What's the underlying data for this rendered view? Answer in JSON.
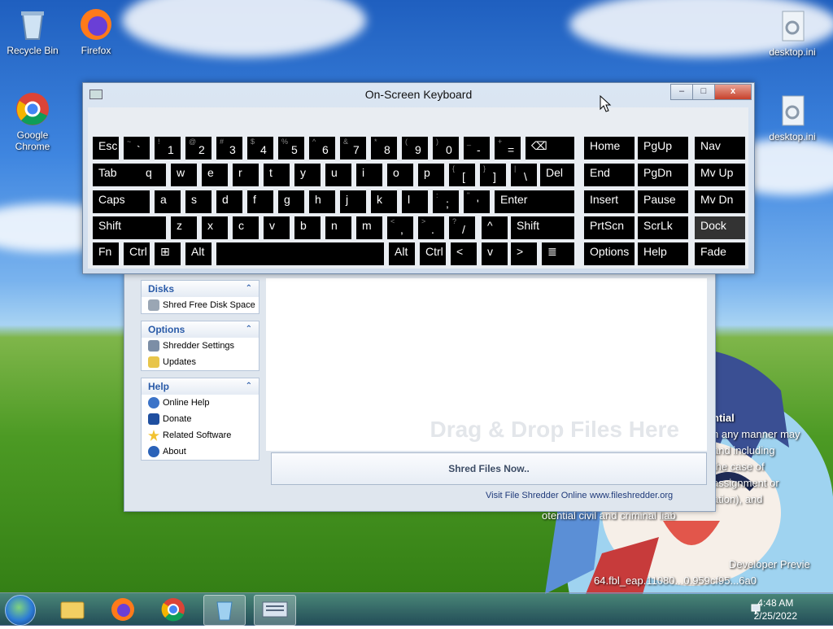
{
  "desktop": {
    "icons": [
      {
        "label": "Recycle Bin",
        "icon": "recycle-bin-icon"
      },
      {
        "label": "Firefox",
        "icon": "firefox-icon"
      },
      {
        "label": "Google Chrome",
        "icon": "chrome-icon"
      },
      {
        "label": "desktop.ini",
        "icon": "settings-file-icon"
      },
      {
        "label": "desktop.ini",
        "icon": "settings-file-icon"
      }
    ],
    "watermark_lines": [
      "ntial",
      "n any manner may",
      "and including",
      "the case of",
      "assignment or",
      "ation), and",
      "otential civil and criminal liab"
    ],
    "watermark_footer": [
      "Developer Previe",
      "64.fbl_eap.11080...0.959cf95...6a0"
    ]
  },
  "osk": {
    "title": "On-Screen Keyboard",
    "minimize": "–",
    "maximize": "□",
    "close": "x"
  },
  "keys": {
    "esc": "Esc",
    "tab": "Tab",
    "caps": "Caps",
    "shift": "Shift",
    "fn": "Fn",
    "ctrl": "Ctrl",
    "alt": "Alt",
    "backspace": "⌫",
    "del": "Del",
    "enter": "Enter",
    "home": "Home",
    "pgup": "PgUp",
    "nav": "Nav",
    "end": "End",
    "pgdn": "PgDn",
    "mvup": "Mv Up",
    "insert": "Insert",
    "pause": "Pause",
    "mvdn": "Mv Dn",
    "prtscn": "PrtScn",
    "scrlk": "ScrLk",
    "dock": "Dock",
    "options": "Options",
    "help": "Help",
    "fade": "Fade",
    "left": "<",
    "down": "v",
    "right": ">",
    "up": "^",
    "menu": "≣",
    "row1": [
      [
        "~",
        "`"
      ],
      [
        "!",
        "1"
      ],
      [
        "@",
        "2"
      ],
      [
        "#",
        "3"
      ],
      [
        "$",
        "4"
      ],
      [
        "%",
        "5"
      ],
      [
        "^",
        "6"
      ],
      [
        "&",
        "7"
      ],
      [
        "*",
        "8"
      ],
      [
        "(",
        "9"
      ],
      [
        ")",
        "0"
      ],
      [
        "_",
        "-"
      ],
      [
        "+",
        "="
      ]
    ],
    "row2": [
      "q",
      "w",
      "e",
      "r",
      "t",
      "y",
      "u",
      "i",
      "o",
      "p",
      [
        "{",
        "["
      ],
      [
        "}",
        "]"
      ],
      [
        "|",
        "\\"
      ]
    ],
    "row3": [
      "a",
      "s",
      "d",
      "f",
      "g",
      "h",
      "j",
      "k",
      "l",
      [
        ":",
        ";"
      ],
      [
        "\"",
        "'"
      ]
    ],
    "row4": [
      "z",
      "x",
      "c",
      "v",
      "b",
      "n",
      "m",
      [
        "<",
        ","
      ],
      [
        ">",
        "."
      ],
      [
        "?",
        "/"
      ]
    ]
  },
  "shredder": {
    "panels": [
      {
        "title": "Disks",
        "items": [
          {
            "label": "Shred Free Disk Space",
            "icon": "disk-icon"
          }
        ]
      },
      {
        "title": "Options",
        "items": [
          {
            "label": "Shredder Settings",
            "icon": "settings-icon"
          },
          {
            "label": "Updates",
            "icon": "updates-icon"
          }
        ]
      },
      {
        "title": "Help",
        "items": [
          {
            "label": "Online Help",
            "icon": "help-icon"
          },
          {
            "label": "Donate",
            "icon": "paypal-icon"
          },
          {
            "label": "Related Software",
            "icon": "star-icon"
          },
          {
            "label": "About",
            "icon": "info-icon"
          }
        ]
      }
    ],
    "dropzone_hint": "Drag & Drop Files Here",
    "shred_button": "Shred Files Now..",
    "status_left": "Visit File Shredder Online",
    "status_right": "www.fileshredder.org"
  },
  "taskbar": {
    "time": "4:48 AM",
    "date": "2/25/2022",
    "apps": [
      "explorer-icon",
      "firefox-icon",
      "chrome-icon",
      "file-shredder-icon",
      "on-screen-keyboard-icon"
    ]
  },
  "colors": {
    "osk_key": "#000000",
    "panel_header": "#2a5ba8",
    "taskbar": "#2a4f84"
  }
}
